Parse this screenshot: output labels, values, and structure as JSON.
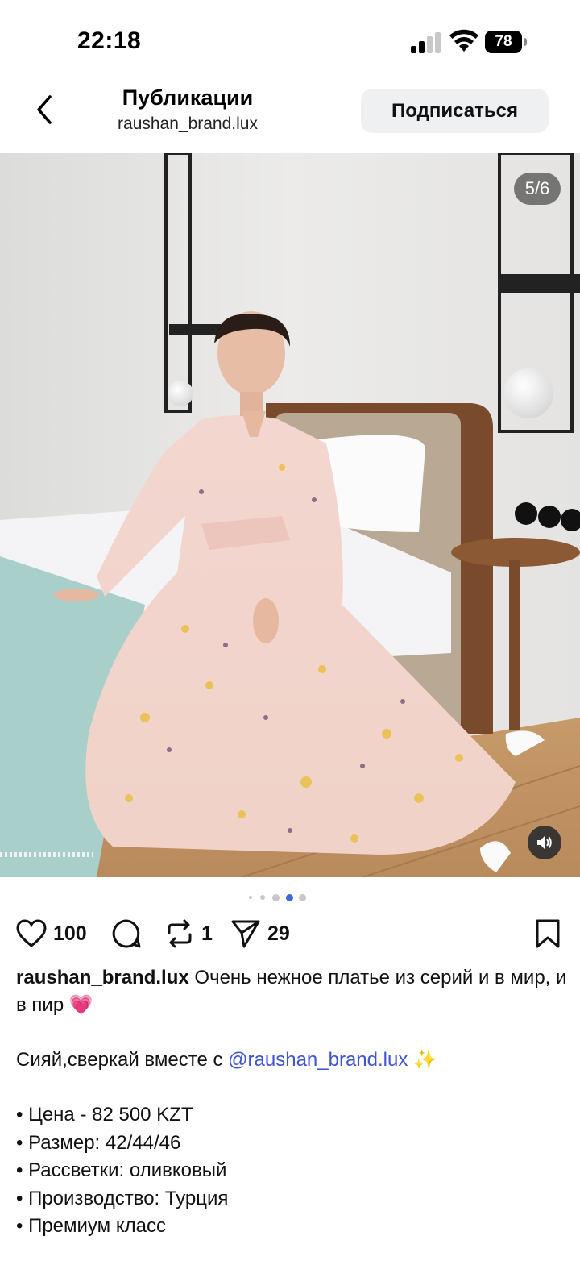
{
  "status": {
    "time": "22:18",
    "battery": "78"
  },
  "header": {
    "title": "Публикации",
    "username": "raushan_brand.lux",
    "follow_label": "Подписаться",
    "back_icon": "chevron-left-icon"
  },
  "media": {
    "counter": "5/6",
    "sound_icon": "speaker-icon",
    "current_index": 4,
    "total": 6
  },
  "actions": {
    "likes": "100",
    "reposts": "1",
    "shares": "29",
    "icons": [
      "heart-icon",
      "comment-icon",
      "repost-icon",
      "send-icon",
      "bookmark-icon"
    ]
  },
  "caption": {
    "username": "raushan_brand.lux",
    "text": " Очень нежное платье из серий и в мир, и в пир 💗",
    "line2_prefix": "Сияй,сверкай вместе с ",
    "mention": "@raushan_brand.lux",
    "line2_suffix": " ✨",
    "bullets": [
      "• Цена - 82 500 KZT",
      "• Размер: 42/44/46",
      "• Рассветки: оливковый",
      "• Производство: Турция",
      "• Премиум класс"
    ]
  },
  "colors": {
    "mention": "#3f55d0",
    "follow_bg": "#eef0f2"
  }
}
